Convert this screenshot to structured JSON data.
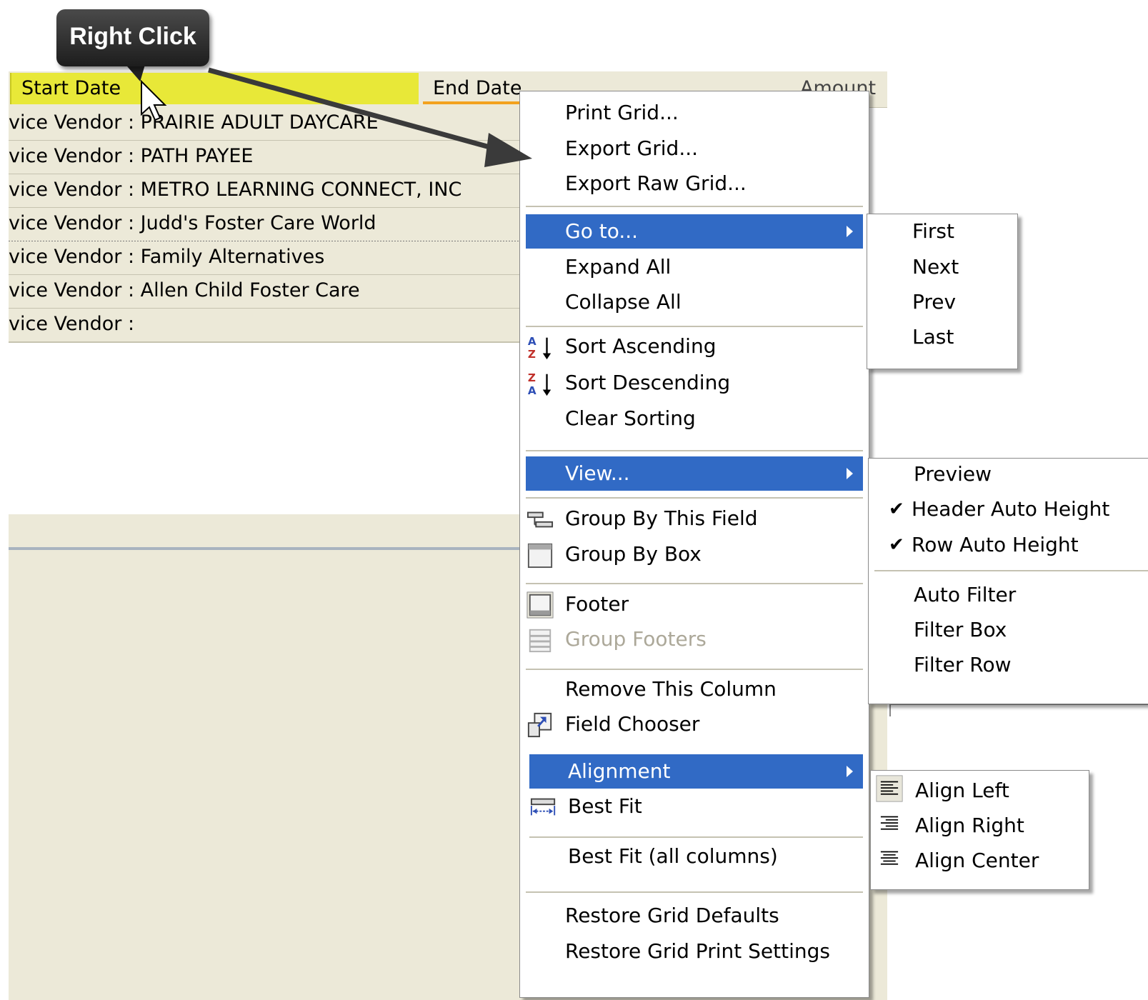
{
  "callout": {
    "text": "Right Click"
  },
  "grid": {
    "columns": [
      "Start Date",
      "End Date",
      "Amount"
    ],
    "rows": [
      "vice Vendor : PRAIRIE ADULT DAYCARE",
      "vice Vendor : PATH PAYEE",
      "vice Vendor : METRO LEARNING CONNECT, INC",
      "vice Vendor : Judd's Foster Care World",
      "vice Vendor : Family Alternatives",
      "vice Vendor : Allen Child Foster Care",
      "vice Vendor :"
    ]
  },
  "context_menu": {
    "print_grid": "Print Grid...",
    "export_grid": "Export Grid...",
    "export_raw_grid": "Export Raw Grid...",
    "go_to": "Go to...",
    "expand_all": "Expand All",
    "collapse_all": "Collapse All",
    "sort_ascending": "Sort Ascending",
    "sort_descending": "Sort Descending",
    "clear_sorting": "Clear Sorting",
    "view": "View...",
    "group_by_this_field": "Group By This Field",
    "group_by_box": "Group By Box",
    "footer": "Footer",
    "group_footers": "Group Footers",
    "remove_this_column": "Remove This Column",
    "field_chooser": "Field Chooser",
    "alignment": "Alignment",
    "best_fit": "Best Fit",
    "best_fit_all": "Best Fit (all columns)",
    "restore_grid_defaults": "Restore Grid Defaults",
    "restore_grid_print_settings": "Restore Grid Print Settings"
  },
  "goto_submenu": {
    "first": "First",
    "next": "Next",
    "prev": "Prev",
    "last": "Last"
  },
  "view_submenu": {
    "preview": "Preview",
    "header_auto_height": "Header Auto Height",
    "row_auto_height": "Row Auto Height",
    "auto_filter": "Auto Filter",
    "filter_box": "Filter Box",
    "filter_row": "Filter Row",
    "checked": {
      "header_auto_height": true,
      "row_auto_height": true
    }
  },
  "alignment_submenu": {
    "align_left": "Align Left",
    "align_right": "Align Right",
    "align_center": "Align Center"
  },
  "colors": {
    "highlight": "#316ac5",
    "header_hot": "#e8e838",
    "menu_bg": "#ffffff",
    "window_bg": "#ece9d8"
  },
  "icons": [
    "sort-ascending-icon",
    "sort-descending-icon",
    "group-by-field-icon",
    "group-by-box-icon",
    "footer-icon",
    "group-footers-icon",
    "field-chooser-icon",
    "best-fit-icon",
    "align-left-icon",
    "align-right-icon",
    "align-center-icon",
    "checkmark-icon",
    "submenu-arrow-icon"
  ]
}
